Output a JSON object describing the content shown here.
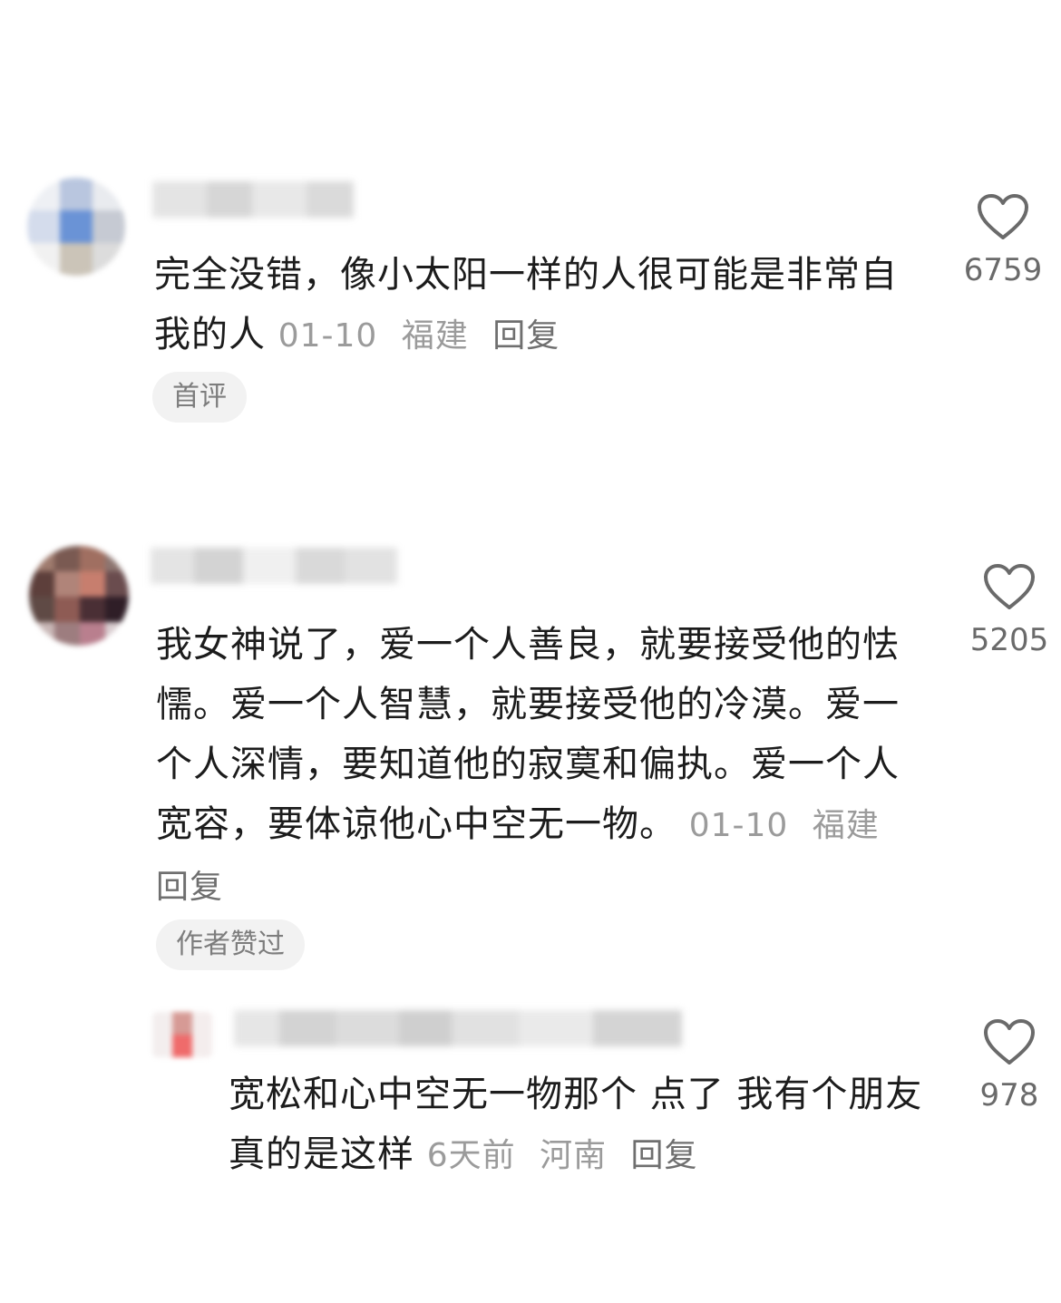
{
  "comments": [
    {
      "text": "完全没错，像小太阳一样的人很可能是非常自我的人",
      "date": "01-10",
      "location": "福建",
      "reply_label": "回复",
      "badge": "首评",
      "likes": "6759"
    },
    {
      "text": "我女神说了，爱一个人善良，就要接受他的怯懦。爱一个人智慧，就要接受他的冷漠。爱一个人深情，要知道他的寂寞和偏执。爱一个人宽容，要体谅他心中空无一物。",
      "date": "01-10",
      "location": "福建",
      "reply_label": "回复",
      "badge": "作者赞过",
      "likes": "5205"
    }
  ],
  "reply": {
    "text": "宽松和心中空无一物那个 点了 我有个朋友真的是这样",
    "date": "6天前",
    "location": "河南",
    "reply_label": "回复",
    "likes": "978"
  },
  "colors": {
    "text": "#1c1c1c",
    "meta": "#9b9b9b",
    "badge_bg": "#f2f2f2",
    "heart": "#6a6a6a"
  },
  "icons": {
    "like": "heart-outline-icon"
  }
}
